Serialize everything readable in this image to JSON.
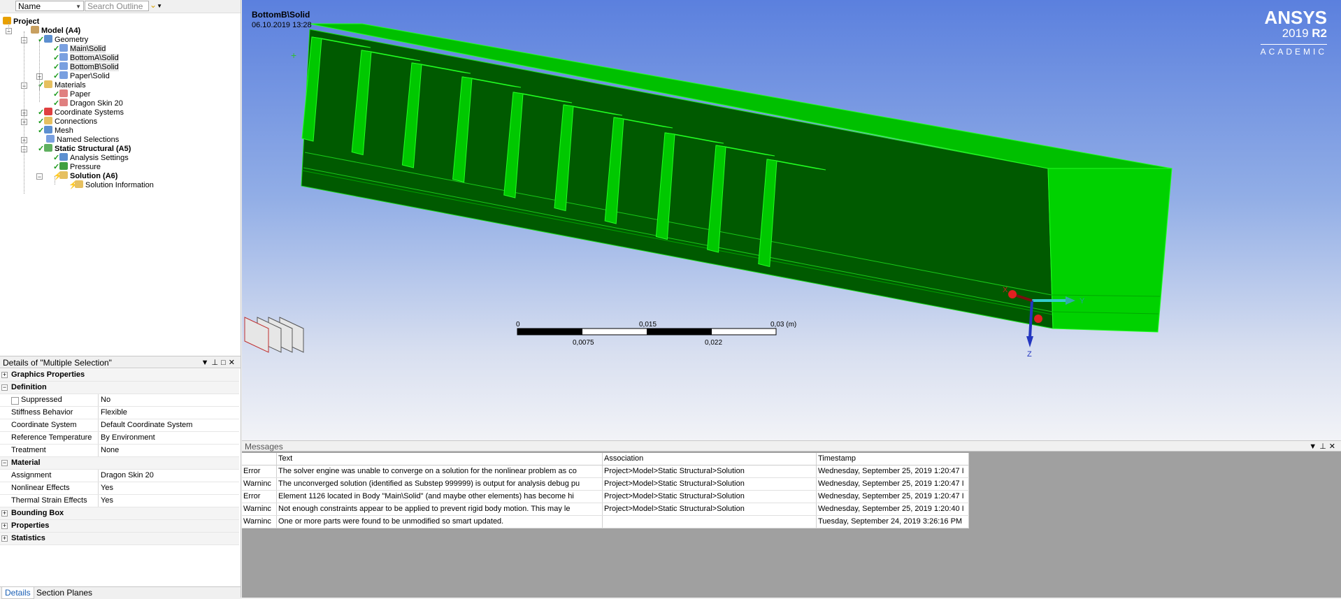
{
  "outline": {
    "name_combo": "Name",
    "search_placeholder": "Search Outline",
    "tree": [
      {
        "label": "Project"
      },
      {
        "label": "Model (A4)"
      },
      {
        "label": "Geometry"
      },
      {
        "label": "Main\\Solid"
      },
      {
        "label": "BottomA\\Solid"
      },
      {
        "label": "BottomB\\Solid"
      },
      {
        "label": "Paper\\Solid"
      },
      {
        "label": "Materials"
      },
      {
        "label": "Paper"
      },
      {
        "label": "Dragon Skin 20"
      },
      {
        "label": "Coordinate Systems"
      },
      {
        "label": "Connections"
      },
      {
        "label": "Mesh"
      },
      {
        "label": "Named Selections"
      },
      {
        "label": "Static Structural (A5)"
      },
      {
        "label": "Analysis Settings"
      },
      {
        "label": "Pressure"
      },
      {
        "label": "Solution (A6)"
      },
      {
        "label": "Solution Information"
      }
    ]
  },
  "details": {
    "title": "Details of \"Multiple Selection\"",
    "rows": [
      {
        "key": "Graphics Properties",
        "value": ""
      },
      {
        "key": "Definition",
        "value": ""
      },
      {
        "key": "Suppressed",
        "value": "No"
      },
      {
        "key": "Stiffness Behavior",
        "value": "Flexible"
      },
      {
        "key": "Coordinate System",
        "value": "Default Coordinate System"
      },
      {
        "key": "Reference Temperature",
        "value": "By Environment"
      },
      {
        "key": "Treatment",
        "value": "None"
      },
      {
        "key": "Material",
        "value": ""
      },
      {
        "key": "Assignment",
        "value": "Dragon Skin 20"
      },
      {
        "key": "Nonlinear Effects",
        "value": "Yes"
      },
      {
        "key": "Thermal Strain Effects",
        "value": "Yes"
      },
      {
        "key": "Bounding Box",
        "value": ""
      },
      {
        "key": "Properties",
        "value": ""
      },
      {
        "key": "Statistics",
        "value": ""
      }
    ],
    "tabs": [
      "Details",
      "Section Planes"
    ]
  },
  "viewport": {
    "object_name": "BottomB\\Solid",
    "date": "06.10.2019 13:28",
    "logo": {
      "brand": "ANSYS",
      "year": "2019",
      "release": "R2",
      "edition": "ACADEMIC"
    },
    "scale": {
      "top_labels": [
        "0",
        "0,015",
        "0,03 (m)"
      ],
      "bottom_labels": [
        "0,0075",
        "0,022"
      ]
    },
    "triad": {
      "x": "X",
      "y": "Y",
      "z": "Z"
    },
    "colors": {
      "body_dark": "#005200",
      "body_light": "#00cc00",
      "edges": "#22ff22"
    }
  },
  "messages": {
    "title": "Messages",
    "columns": [
      "Text",
      "Association",
      "Timestamp"
    ],
    "rows": [
      {
        "type": "Error",
        "text": "The solver engine was unable to converge on a solution for the nonlinear problem as co",
        "assoc": "Project>Model>Static Structural>Solution",
        "time": "Wednesday, September 25, 2019 1:20:47 I"
      },
      {
        "type": "Warninc",
        "text": "The unconverged solution (identified as Substep 999999) is output for analysis debug pu",
        "assoc": "Project>Model>Static Structural>Solution",
        "time": "Wednesday, September 25, 2019 1:20:47 I"
      },
      {
        "type": "Error",
        "text": "Element 1126 located in Body \"Main\\Solid\" (and maybe other elements) has become hi",
        "assoc": "Project>Model>Static Structural>Solution",
        "time": "Wednesday, September 25, 2019 1:20:47 I"
      },
      {
        "type": "Warninc",
        "text": "Not enough constraints appear to be applied to prevent rigid body motion.  This may le",
        "assoc": "Project>Model>Static Structural>Solution",
        "time": "Wednesday, September 25, 2019 1:20:40 I"
      },
      {
        "type": "Warninc",
        "text": "One or more parts were found to be unmodified so smart updated.",
        "assoc": "",
        "time": "Tuesday, September 24, 2019 3:26:16 PM"
      }
    ]
  }
}
